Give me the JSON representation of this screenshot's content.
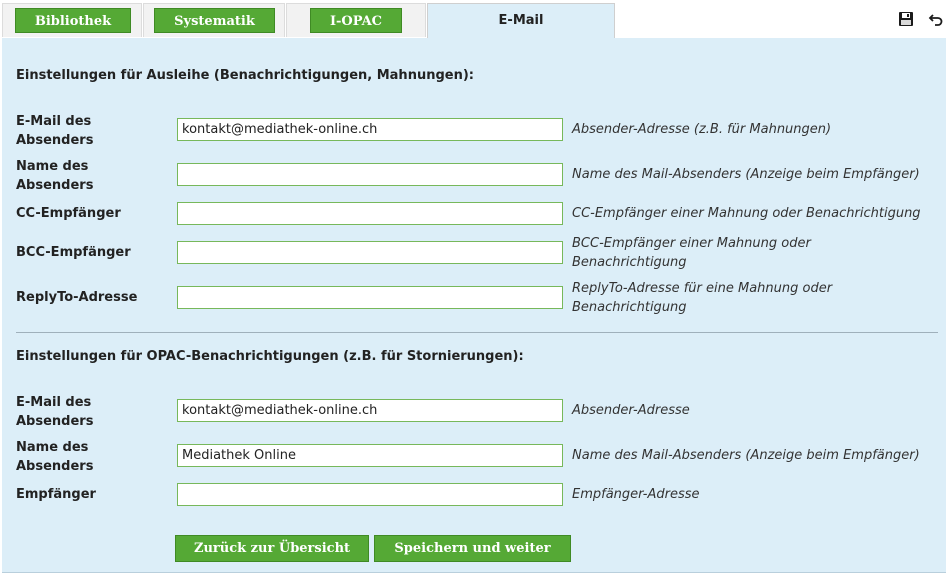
{
  "tabs": {
    "bibliothek": "Bibliothek",
    "systematik": "Systematik",
    "iopac": "I-OPAC",
    "email": "E-Mail"
  },
  "colors": {
    "accent_green": "#55a935",
    "panel_bg": "#dceef8"
  },
  "icons": {
    "save": "save-icon",
    "undo": "undo-icon"
  },
  "section1": {
    "title": "Einstellungen für Ausleihe (Benachrichtigungen, Mahnungen):",
    "fields": [
      {
        "label_line1": "E-Mail des",
        "label_line2": "Absenders",
        "value": "kontakt@mediathek-online.ch",
        "hint_line1": "Absender-Adresse (z.B. für Mahnungen)",
        "hint_line2": ""
      },
      {
        "label_line1": "Name des",
        "label_line2": "Absenders",
        "value": "",
        "hint_line1": "Name des Mail-Absenders (Anzeige beim Empfänger)",
        "hint_line2": ""
      },
      {
        "label_line1": "CC-Empfänger",
        "label_line2": "",
        "value": "",
        "hint_line1": "CC-Empfänger einer Mahnung oder Benachrichtigung",
        "hint_line2": ""
      },
      {
        "label_line1": "BCC-Empfänger",
        "label_line2": "",
        "value": "",
        "hint_line1": "BCC-Empfänger einer Mahnung oder",
        "hint_line2": "Benachrichtigung"
      },
      {
        "label_line1": "ReplyTo-Adresse",
        "label_line2": "",
        "value": "",
        "hint_line1": "ReplyTo-Adresse für eine Mahnung oder",
        "hint_line2": "Benachrichtigung"
      }
    ]
  },
  "section2": {
    "title": "Einstellungen für OPAC-Benachrichtigungen (z.B. für Stornierungen):",
    "fields": [
      {
        "label_line1": "E-Mail des",
        "label_line2": "Absenders",
        "value": "kontakt@mediathek-online.ch",
        "hint_line1": "Absender-Adresse",
        "hint_line2": ""
      },
      {
        "label_line1": "Name des",
        "label_line2": "Absenders",
        "value": "Mediathek Online",
        "hint_line1": "Name des Mail-Absenders (Anzeige beim Empfänger)",
        "hint_line2": ""
      },
      {
        "label_line1": "Empfänger",
        "label_line2": "",
        "value": "",
        "hint_line1": "Empfänger-Adresse",
        "hint_line2": ""
      }
    ]
  },
  "buttons": {
    "back": "Zurück zur Übersicht",
    "save_continue": "Speichern und weiter"
  }
}
